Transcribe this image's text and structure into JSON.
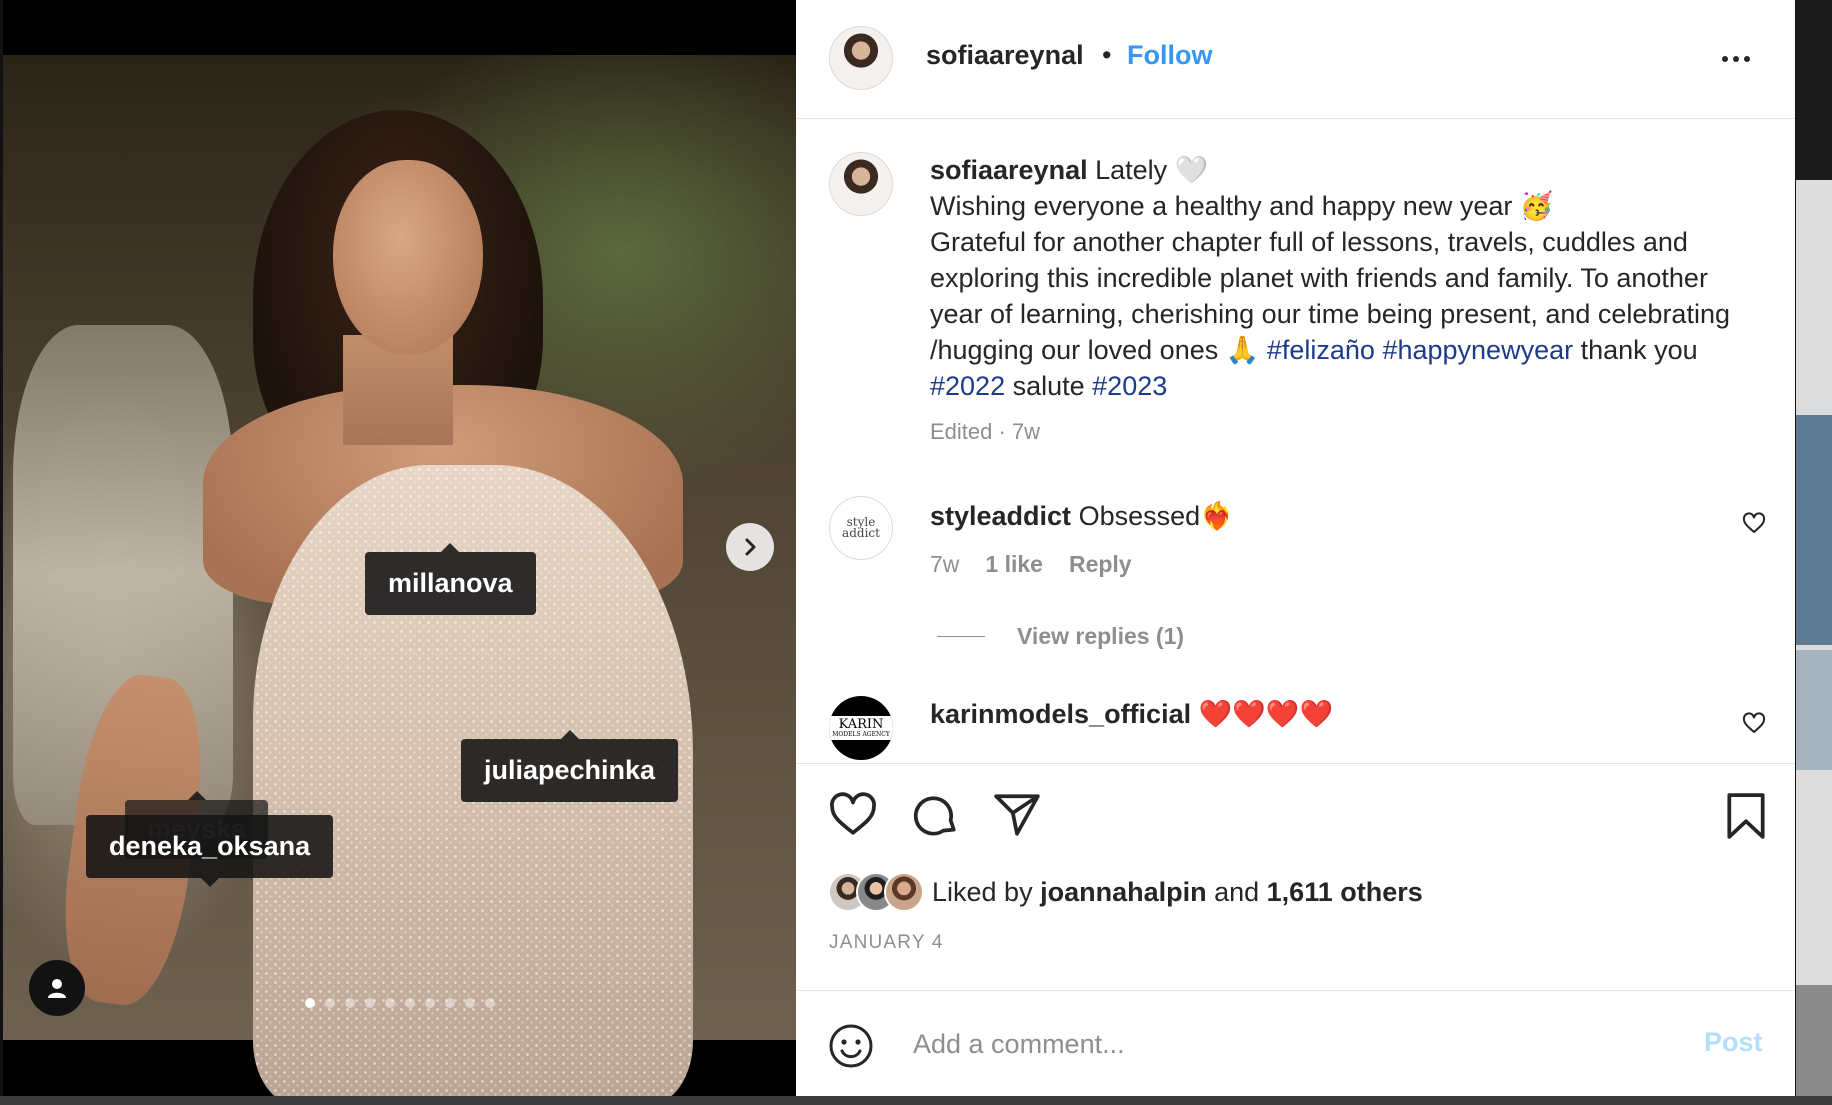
{
  "post": {
    "username": "sofiaareynal",
    "separator": "•",
    "follow_label": "Follow",
    "more_icon": "more-horizontal-icon"
  },
  "photo": {
    "tags": {
      "t1": "millanova",
      "t2": "juliapechinka",
      "t3": "meyska",
      "t4": "deneka_oksana"
    },
    "carousel_count": 10,
    "carousel_active": 1
  },
  "caption": {
    "username": "sofiaareynal",
    "line1": " Lately 🤍",
    "line2": "Wishing everyone a healthy and happy new year 🥳",
    "line3a": "Grateful for another chapter full of lessons, travels, cuddles and exploring this incredible planet with friends and family. To another year of learning, cherishing our time being present, and celebrating /hugging our loved ones 🙏 ",
    "hashtag1": "#felizaño",
    "hashtag2": "#happynewyear",
    "text_mid": " thank you ",
    "hashtag3": "#2022",
    "text_mid2": " salute ",
    "hashtag4": "#2023",
    "meta": "Edited · 7w"
  },
  "comments": [
    {
      "username": "styleaddict",
      "text": " Obsessed❤️‍🔥",
      "time": "7w",
      "likes": "1 like",
      "reply_label": "Reply",
      "avatar_text": "style addict"
    },
    {
      "username": "karinmodels_official",
      "text": " ❤️❤️❤️❤️",
      "avatar_text": "KARIN",
      "avatar_sub": "MODELS AGENCY"
    }
  ],
  "view_replies": "View replies (1)",
  "likes": {
    "prefix": "Liked by ",
    "user": "joannahalpin",
    "middle": " and ",
    "others": "1,611 others"
  },
  "date": "JANUARY 4",
  "comment_box": {
    "placeholder": "Add a comment...",
    "post_label": "Post"
  },
  "colors": {
    "link_blue": "#3897f0",
    "hashtag": "#1c3b8a",
    "muted": "#8e8e8e",
    "post_disabled": "#b2dffc"
  }
}
